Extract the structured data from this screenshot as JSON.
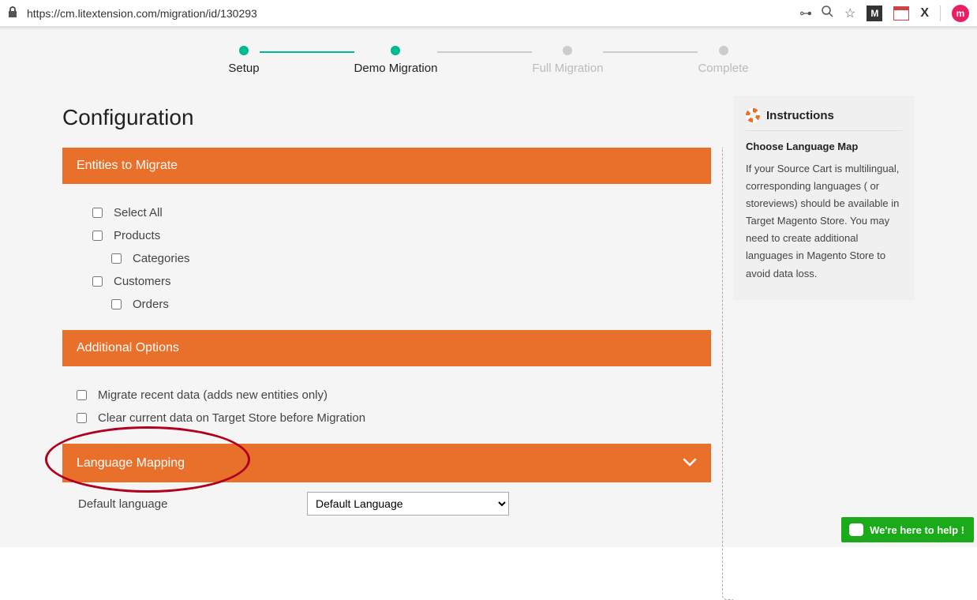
{
  "browser": {
    "url": "https://cm.litextension.com/migration/id/130293",
    "avatar_initial": "m",
    "ext_label": "M",
    "ext_x": "X"
  },
  "stepper": {
    "steps": [
      {
        "label": "Setup",
        "done": true,
        "active": true
      },
      {
        "label": "Demo Migration",
        "done": true,
        "active": true
      },
      {
        "label": "Full Migration",
        "done": false,
        "active": false
      },
      {
        "label": "Complete",
        "done": false,
        "active": false
      }
    ]
  },
  "page_title": "Configuration",
  "sections": {
    "entities": {
      "title": "Entities to Migrate",
      "items": {
        "select_all": "Select All",
        "products": "Products",
        "categories": "Categories",
        "customers": "Customers",
        "orders": "Orders"
      }
    },
    "additional": {
      "title": "Additional Options",
      "items": {
        "recent": "Migrate recent data (adds new entities only)",
        "clear": "Clear current data on Target Store before Migration"
      }
    },
    "language": {
      "title": "Language Mapping",
      "default_label": "Default language",
      "default_option": "Default Language"
    }
  },
  "instructions": {
    "heading": "Instructions",
    "subheading": "Choose Language Map",
    "body": "If your Source Cart is multilingual, corresponding languages ( or storeviews) should be available in Target Magento Store. You may need to create additional languages in Magento Store to avoid data loss."
  },
  "help_widget": "We're here to help !"
}
